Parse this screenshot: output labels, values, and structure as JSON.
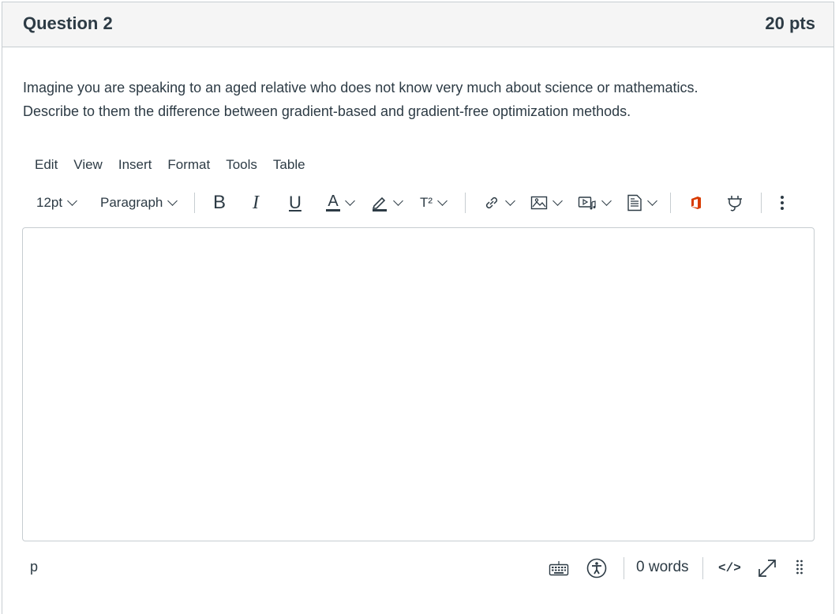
{
  "question": {
    "title": "Question 2",
    "points": "20 pts",
    "text_lines": [
      "Imagine you are speaking to an aged relative who does not know very much about science or mathematics.",
      "Describe to them the difference between gradient-based and gradient-free optimization methods."
    ]
  },
  "editor": {
    "menu": [
      "Edit",
      "View",
      "Insert",
      "Format",
      "Tools",
      "Table"
    ],
    "toolbar": {
      "font_size": "12pt",
      "block_format": "Paragraph",
      "bold": "B",
      "italic": "I",
      "underline": "U",
      "text_color": "A",
      "superscript": "T²",
      "icons": [
        "text-color-icon",
        "highlight-icon",
        "superscript-icon",
        "link-icon",
        "image-icon",
        "media-icon",
        "document-icon",
        "office-365-icon",
        "plug-icon",
        "more-icon"
      ]
    },
    "content": "",
    "status": {
      "path": "p",
      "word_count": "0 words",
      "html_toggle": "</>"
    },
    "colors": {
      "text": "#2d3b45",
      "border": "#c7cdd1",
      "header_bg": "#f5f5f5",
      "office_red": "#d83b01"
    }
  }
}
